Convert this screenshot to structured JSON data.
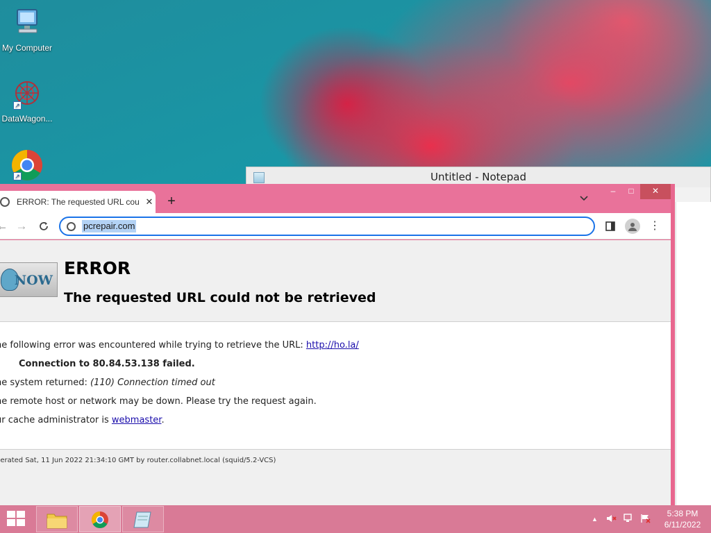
{
  "desktop": {
    "icons": [
      {
        "label": "My Computer"
      },
      {
        "label": "DataWagon..."
      },
      {
        "label": ""
      }
    ]
  },
  "notepad": {
    "title": "Untitled - Notepad"
  },
  "browser": {
    "tab_title": "ERROR: The requested URL could",
    "tab_close": "✕",
    "new_tab": "+",
    "address": "pcrepair.com",
    "controls": {
      "minimize": "–",
      "maximize": "□",
      "close": "✕"
    }
  },
  "page": {
    "logo_text": "NOW",
    "heading": "ERROR",
    "subheading": "The requested URL could not be retrieved",
    "intro_text": "he following error was encountered while trying to retrieve the URL: ",
    "intro_link": "http://ho.la/",
    "connection_error": "Connection to 80.84.53.138 failed.",
    "system_prefix": "he system returned: ",
    "system_message": "(110) Connection timed out",
    "remote_host": "he remote host or network may be down. Please try the request again.",
    "admin_prefix": "ur cache administrator is ",
    "admin_link": "webmaster",
    "admin_suffix": ".",
    "generated": "nerated Sat, 11 Jun 2022 21:34:10 GMT by router.collabnet.local (squid/5.2-VCS)"
  },
  "taskbar": {
    "time": "5:38 PM",
    "date": "6/11/2022"
  },
  "colors": {
    "accent": "#e8678f",
    "omnibox_focus": "#1a73e8",
    "link": "#1a0dab"
  }
}
